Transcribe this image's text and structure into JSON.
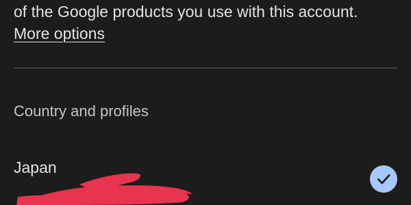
{
  "account_info": {
    "description_tail": "of the Google products you use with this account.",
    "more_options_link": "More options"
  },
  "country_section": {
    "heading": "Country and profiles",
    "selected_country": {
      "name": "Japan",
      "selected": true
    }
  },
  "colors": {
    "background": "#1c1c1c",
    "text_primary": "#e3e3e3",
    "text_secondary": "#c4c7c5",
    "divider": "#5f5f5f",
    "check_badge": "#a8c7fa",
    "check_mark": "#1c1c1c",
    "redaction_mark": "#e8344e"
  },
  "icons": {
    "selected_indicator": "check-circle-icon"
  }
}
